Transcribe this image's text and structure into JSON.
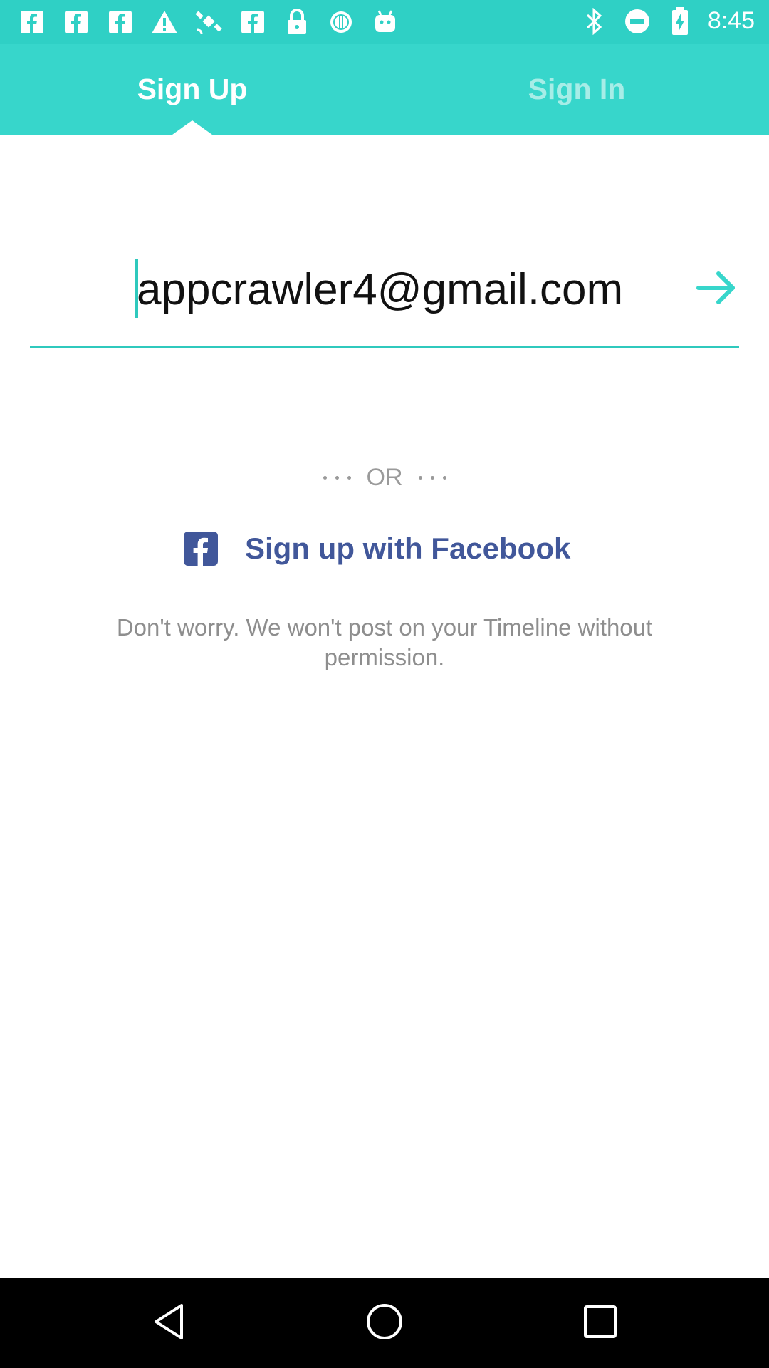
{
  "status_bar": {
    "time": "8:45",
    "left_icons": [
      "facebook-icon",
      "facebook-icon",
      "facebook-icon",
      "warning-icon",
      "satellite-icon",
      "facebook-icon",
      "lock-icon",
      "circle-icon",
      "android-icon"
    ],
    "right_icons": [
      "bluetooth-icon",
      "minus-circle-icon",
      "battery-charging-icon"
    ]
  },
  "tabs": [
    {
      "label": "Sign Up",
      "active": true
    },
    {
      "label": "Sign In",
      "active": false
    }
  ],
  "email_field": {
    "value": "appcrawler4@gmail.com",
    "submit_icon": "arrow-right-icon"
  },
  "separator": {
    "text": "OR"
  },
  "facebook": {
    "label": "Sign up with Facebook",
    "icon": "facebook-icon"
  },
  "disclaimer": "Don't worry. We won't post on your Timeline without permission.",
  "colors": {
    "accent": "#37d6cb",
    "status_bar": "#2fd0c5",
    "facebook": "#41579a",
    "muted_text": "#8e8e8e"
  },
  "nav_bar": {
    "icons": [
      "back-icon",
      "home-icon",
      "recents-icon"
    ]
  }
}
